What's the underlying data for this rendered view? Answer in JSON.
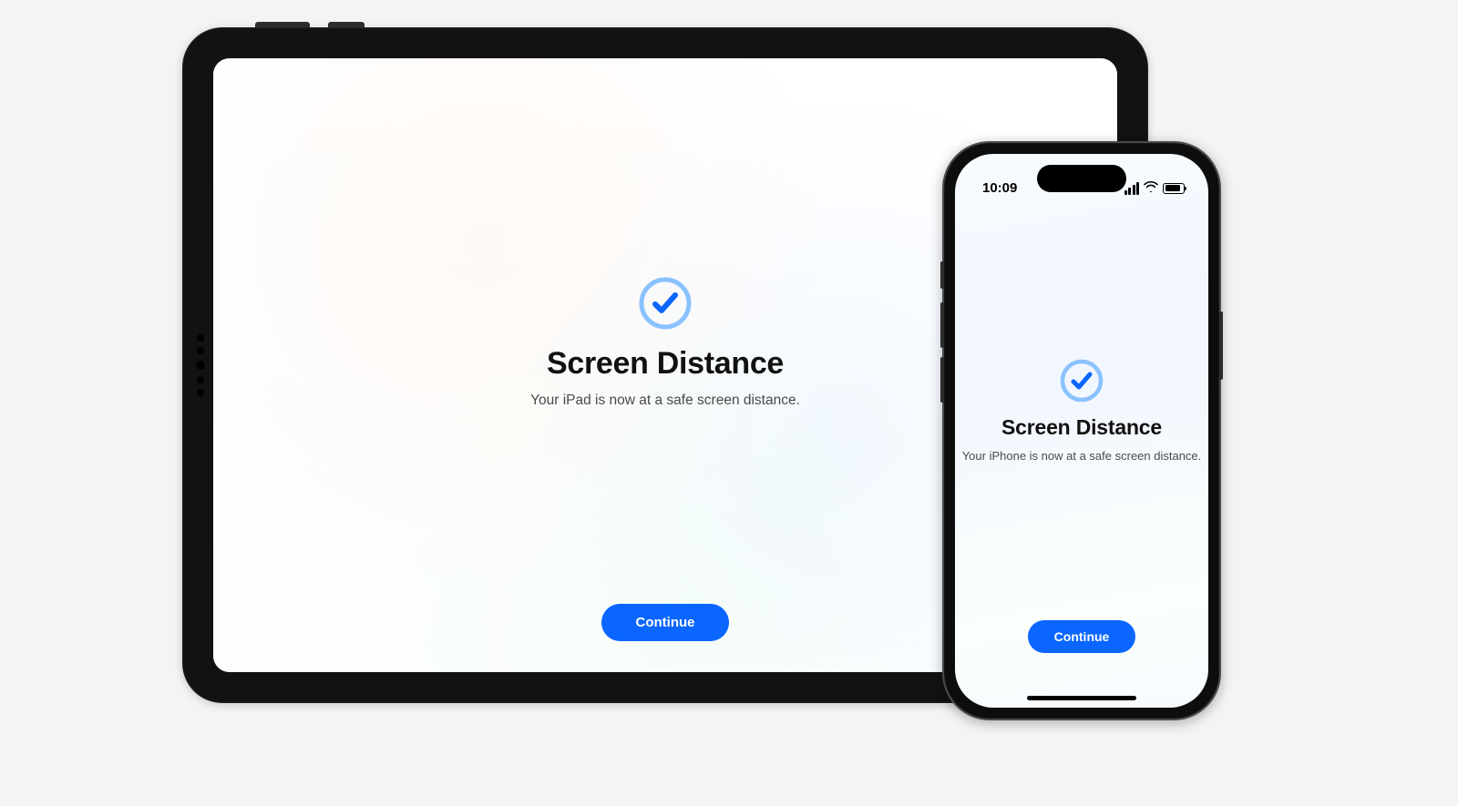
{
  "colors": {
    "accent": "#0a66ff",
    "accentLight": "#8ac2ff"
  },
  "ipad": {
    "title": "Screen Distance",
    "subtitle": "Your iPad is now at a safe screen distance.",
    "continue_label": "Continue"
  },
  "iphone": {
    "status": {
      "time": "10:09"
    },
    "title": "Screen Distance",
    "subtitle": "Your iPhone is now at a safe screen distance.",
    "continue_label": "Continue"
  }
}
